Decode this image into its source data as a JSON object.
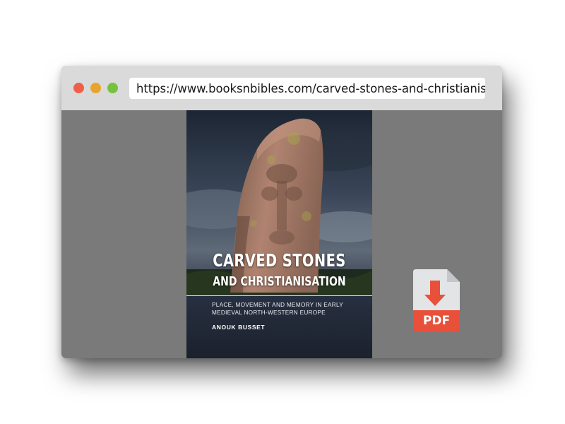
{
  "window": {
    "controls": [
      "close",
      "minimize",
      "maximize"
    ],
    "colors": {
      "close": "#ee5f48",
      "minimize": "#e9a42d",
      "maximize": "#76c23c"
    }
  },
  "address_bar": {
    "url": "https://www.booksnbibles.com/carved-stones-and-christianisation-place-movement-and-memory"
  },
  "book_cover": {
    "title_line1": "CARVED STONES",
    "title_line2": "AND CHRISTIANISATION",
    "subtitle_line1": "PLACE, MOVEMENT AND MEMORY IN EARLY",
    "subtitle_line2": "MEDIEVAL NORTH-WESTERN EUROPE",
    "author": "ANOUK BUSSET"
  },
  "download": {
    "icon": "pdf-download-icon",
    "label": "PDF",
    "accent_color": "#e8503a"
  }
}
